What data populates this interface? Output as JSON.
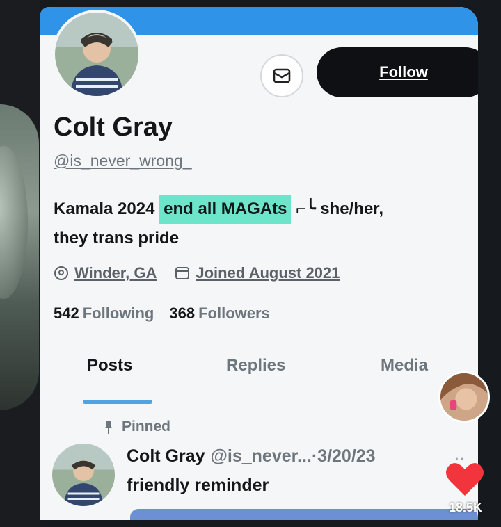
{
  "profile": {
    "name": "Colt Gray",
    "handle": "@is_never_wrong_",
    "follow_label": "Follow",
    "bio_line1_start": "Kamala 2024 ",
    "bio_highlight": "end all MAGAts",
    "bio_line1_end": " ⌐╰ she/her,",
    "bio_line2": "they trans pride",
    "location": "Winder, GA",
    "joined": "Joined August 2021",
    "following_count": "542",
    "following_label": "Following",
    "followers_count": "368",
    "followers_label": "Followers"
  },
  "tabs": [
    {
      "label": "Posts"
    },
    {
      "label": "Replies"
    },
    {
      "label": "Media"
    }
  ],
  "pinned_post": {
    "pinned_label": "Pinned",
    "author_name": "Colt Gray",
    "author_handle": "@is_never...",
    "date": "·3/20/23",
    "text": "friendly reminder"
  },
  "overlay": {
    "like_count": "18.5K"
  },
  "colors": {
    "banner": "#2f94e8",
    "highlight": "#46e0be",
    "tab_indicator": "#4fa3e0",
    "heart": "#f2353d"
  }
}
